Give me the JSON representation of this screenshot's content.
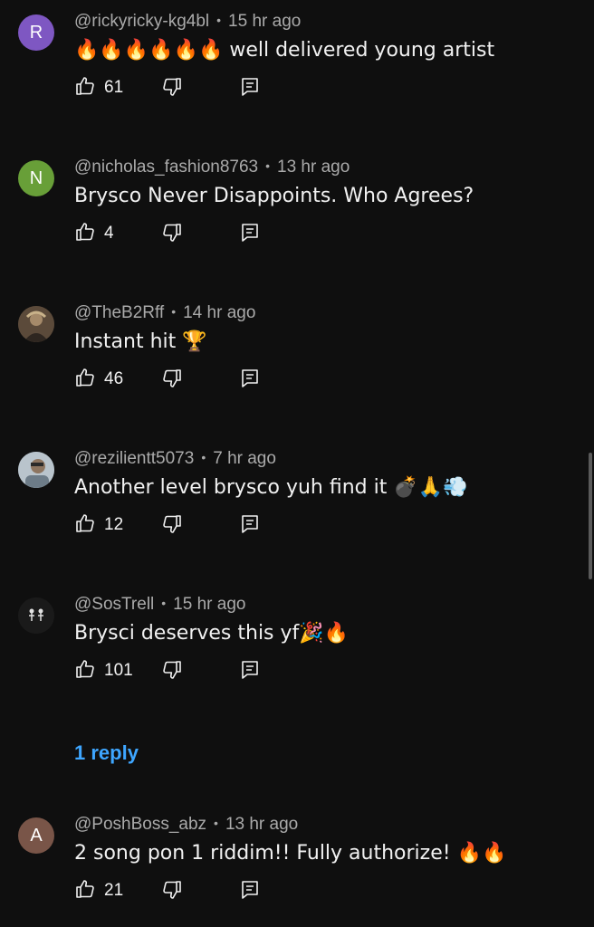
{
  "comments": [
    {
      "avatar_letter": "R",
      "avatar_color": "#7e57c2",
      "author": "@rickyricky-kg4bl",
      "time": "15 hr ago",
      "text": "🔥🔥🔥🔥🔥🔥 well delivered young artist",
      "likes": "61"
    },
    {
      "avatar_letter": "N",
      "avatar_color": "#689f38",
      "author": "@nicholas_fashion8763",
      "time": "13 hr ago",
      "text": "Brysco Never Disappoints. Who Agrees?",
      "likes": "4"
    },
    {
      "avatar_letter": "",
      "avatar_color": "#4a3f35",
      "author": "@TheB2Rff",
      "time": "14 hr ago",
      "text": "Instant hit 🏆",
      "likes": "46"
    },
    {
      "avatar_letter": "",
      "avatar_color": "#8a9aa6",
      "author": "@rezilientt5073",
      "time": "7 hr ago",
      "text": "Another level brysco yuh find it 💣🙏💨",
      "likes": "12"
    },
    {
      "avatar_letter": "",
      "avatar_color": "#1a1a1a",
      "author": "@SosTrell",
      "time": "15 hr ago",
      "text": "Brysci deserves this yf🎉🔥",
      "likes": "101",
      "replies": "1 reply"
    },
    {
      "avatar_letter": "A",
      "avatar_color": "#795548",
      "author": "@PoshBoss_abz",
      "time": "13 hr ago",
      "text": "2 song pon 1 riddim!! Fully authorize! 🔥🔥",
      "likes": "21"
    }
  ],
  "icons": {
    "like": "thumb-up-icon",
    "dislike": "thumb-down-icon",
    "reply": "reply-icon"
  },
  "colors": {
    "background": "#0f0f0f",
    "text": "#f1f1f1",
    "meta": "#aaaaaa",
    "link": "#3ea6ff"
  }
}
